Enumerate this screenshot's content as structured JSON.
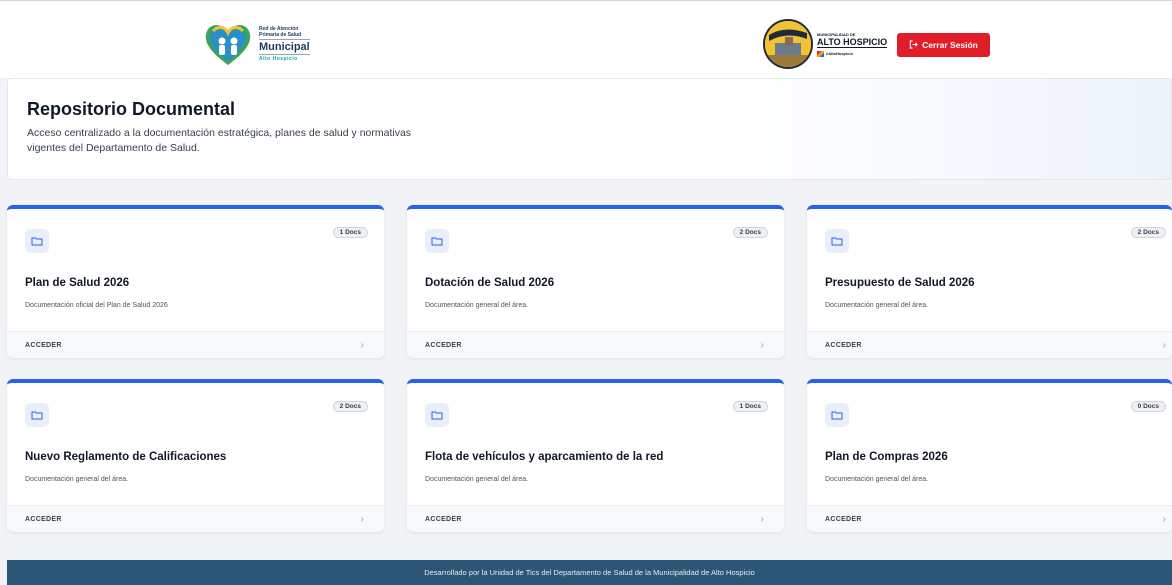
{
  "header": {
    "left_logo": {
      "line1": "Red de Atención",
      "line2": "Primaria de Salud",
      "line3": "Municipal",
      "line4": "Alto Hospicio"
    },
    "right_logo": {
      "small": "MUNICIPALIDAD DE",
      "name": "ALTO HOSPICIO",
      "tag": "#AltoHospicio"
    },
    "logout_label": "Cerrar Sesión"
  },
  "hero": {
    "title": "Repositorio Documental",
    "description": "Acceso centralizado a la documentación estratégica, planes de salud y normativas vigentes del Departamento de Salud."
  },
  "cards": [
    {
      "title": "Plan de Salud 2026",
      "badge": "1 Docs",
      "description": "Documentación oficial del Plan de Salud 2026",
      "action": "ACCEDER"
    },
    {
      "title": "Dotación de Salud 2026",
      "badge": "2 Docs",
      "description": "Documentación general del área.",
      "action": "ACCEDER"
    },
    {
      "title": "Presupuesto de Salud 2026",
      "badge": "2 Docs",
      "description": "Documentación general del área.",
      "action": "ACCEDER"
    },
    {
      "title": "Nuevo Reglamento de Calificaciones",
      "badge": "2 Docs",
      "description": "Documentación general del área.",
      "action": "ACCEDER"
    },
    {
      "title": "Flota de vehículos y aparcamiento de la red",
      "badge": "1 Docs",
      "description": "Documentación general del área.",
      "action": "ACCEDER"
    },
    {
      "title": "Plan de Compras 2026",
      "badge": "0 Docs",
      "description": "Documentación general del área.",
      "action": "ACCEDER"
    }
  ],
  "footer": {
    "text": "Desarrollado por la Unidad de Tics del Departamento de Salud de la Municipalidad de Alto Hospicio"
  },
  "colors": {
    "accent": "#2563eb",
    "logout": "#e11d2a",
    "footer": "#2b5675"
  }
}
